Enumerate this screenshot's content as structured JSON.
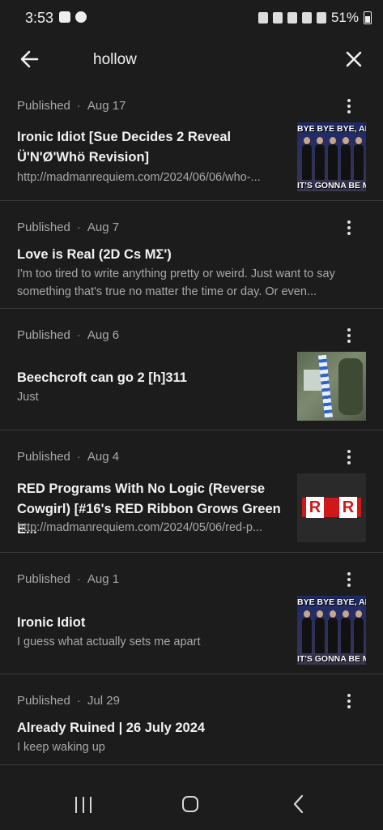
{
  "status_bar": {
    "time": "3:53",
    "battery": "51%"
  },
  "search": {
    "query": "hollow"
  },
  "posts": [
    {
      "status": "Published",
      "date": "Aug 17",
      "title": "Ironic Idiot [Sue Decides 2 Reveal Ü'N'Ø'Whö Revision]",
      "excerpt": "http://madmanrequiem.com/2024/06/06/who-...",
      "thumbnail": "nsync-meme",
      "thumb_caption_top": "BYE BYE BYE, APRIL",
      "thumb_caption_bottom": "IT'S GONNA BE MAY"
    },
    {
      "status": "Published",
      "date": "Aug 7",
      "title": "Love is Real (2D Cs MΣ')",
      "excerpt": "I'm too tired to write anything pretty or weird. Just want to say something that's true no matter the time or day. Or even..."
    },
    {
      "status": "Published",
      "date": "Aug 6",
      "title": "Beechcroft can go 2 [h]311",
      "excerpt": "Just",
      "thumbnail": "flag-photo"
    },
    {
      "status": "Published",
      "date": "Aug 4",
      "title": "RED Programs With No Logic (Reverse Cowgirl) [#16's RED Ribbon Grows Green E...",
      "excerpt": "http://madmanrequiem.com/2024/05/06/red-p...",
      "thumbnail": "red-ribbon-logo",
      "thumb_letters": [
        "R",
        "R"
      ]
    },
    {
      "status": "Published",
      "date": "Aug 1",
      "title": "Ironic Idiot",
      "excerpt": "I guess what actually sets me apart",
      "thumbnail": "nsync-meme",
      "thumb_caption_top": "BYE BYE BYE, APRIL",
      "thumb_caption_bottom": "IT'S GONNA BE MAY"
    },
    {
      "status": "Published",
      "date": "Jul 29",
      "title": "Already Ruined | 26 July 2024",
      "excerpt": "I keep waking up"
    }
  ],
  "icons": {
    "back": "arrow-left-icon",
    "close": "close-icon",
    "more": "more-vertical-icon"
  }
}
